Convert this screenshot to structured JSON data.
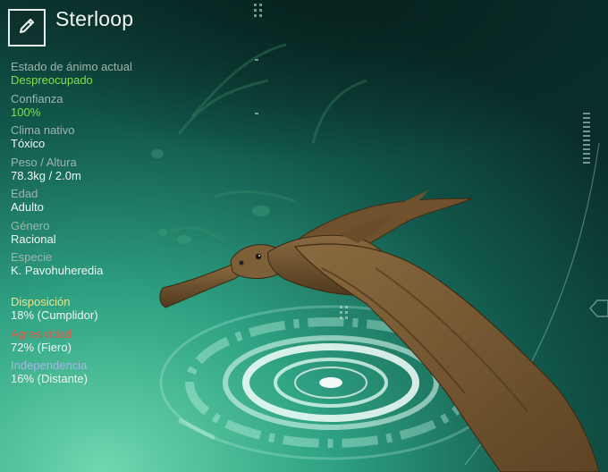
{
  "header": {
    "edit_icon": "pencil-icon",
    "title": "Sterloop"
  },
  "stats": [
    {
      "label": "Estado de ánimo actual",
      "value": "Despreocupado",
      "accent": "#7fe04c"
    },
    {
      "label": "Confianza",
      "value": "100%",
      "accent": "#7fe04c"
    },
    {
      "label": "Clima nativo",
      "value": "Tóxico"
    },
    {
      "label": "Peso / Altura",
      "value": "78.3kg / 2.0m"
    },
    {
      "label": "Edad",
      "value": "Adulto"
    },
    {
      "label": "Género",
      "value": "Racional"
    },
    {
      "label": "Especie",
      "value": "K. Pavohuheredia"
    }
  ],
  "traits": [
    {
      "label": "Disposición",
      "value": "18% (Cumplidor)",
      "color": "#e9e58a"
    },
    {
      "label": "Agresividad",
      "value": "72% (Fiero)",
      "color": "#e2574a"
    },
    {
      "label": "Independencia",
      "value": "16% (Distante)",
      "color": "#a9b8e8"
    }
  ],
  "colors": {
    "accent_green": "#7fe04c",
    "background_dark": "#0b3a33",
    "background_glow": "#59c9a4"
  }
}
